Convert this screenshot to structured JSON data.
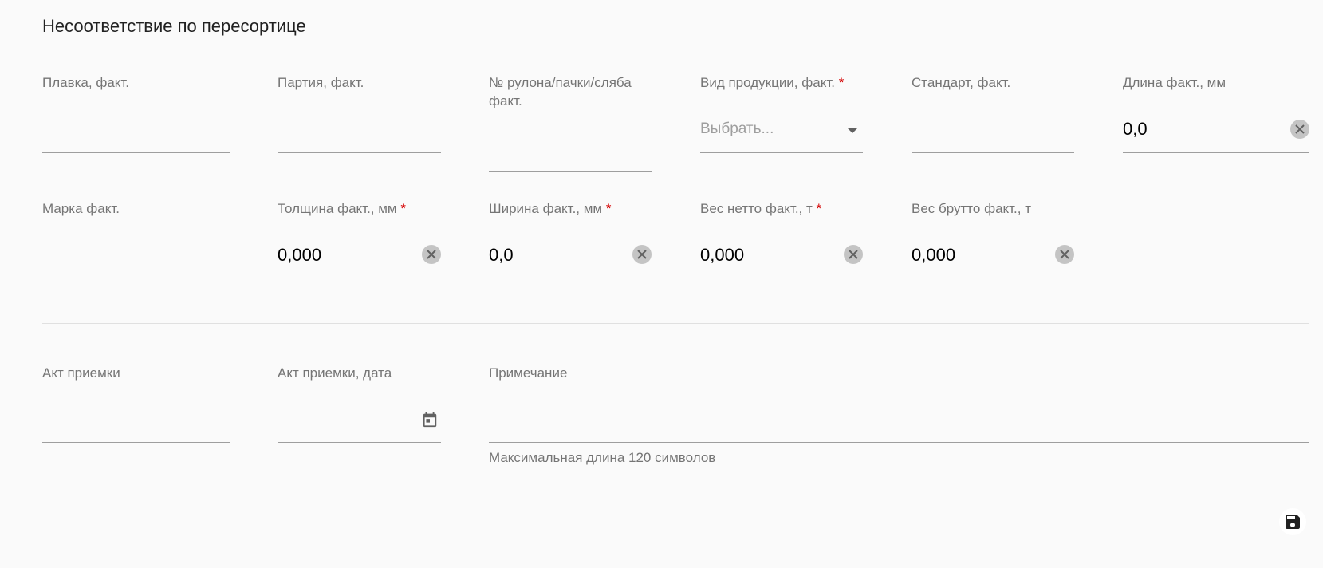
{
  "form": {
    "title": "Несоответствие по пересортице",
    "required_mark": "*",
    "fields": {
      "melt": {
        "label": "Плавка, факт.",
        "value": ""
      },
      "batch": {
        "label": "Партия, факт.",
        "value": ""
      },
      "coil_number": {
        "label": "№ рулона/пачки/сляба факт.",
        "value": ""
      },
      "product_type": {
        "label": "Вид продукции, факт.",
        "placeholder": "Выбрать...",
        "value": ""
      },
      "standard": {
        "label": "Стандарт, факт.",
        "value": ""
      },
      "length": {
        "label": "Длина факт., мм",
        "value": "0,0"
      },
      "grade": {
        "label": "Марка факт.",
        "value": ""
      },
      "thickness": {
        "label": "Толщина факт., мм",
        "value": "0,000"
      },
      "width": {
        "label": "Ширина факт., мм",
        "value": "0,0"
      },
      "net_weight": {
        "label": "Вес нетто факт., т",
        "value": "0,000"
      },
      "gross_weight": {
        "label": "Вес брутто факт., т",
        "value": "0,000"
      },
      "acceptance_act": {
        "label": "Акт приемки",
        "value": ""
      },
      "acceptance_date": {
        "label": "Акт приемки, дата",
        "value": ""
      },
      "note": {
        "label": "Примечание",
        "value": "",
        "hint": "Максимальная длина 120 символов"
      }
    }
  },
  "icons": {
    "clear": "close-icon",
    "dropdown": "chevron-down-icon",
    "calendar": "calendar-icon",
    "save": "save-icon"
  },
  "colors": {
    "background": "#fafafa",
    "required": "#d50000",
    "label": "#757575",
    "underline": "#9e9e9e"
  }
}
